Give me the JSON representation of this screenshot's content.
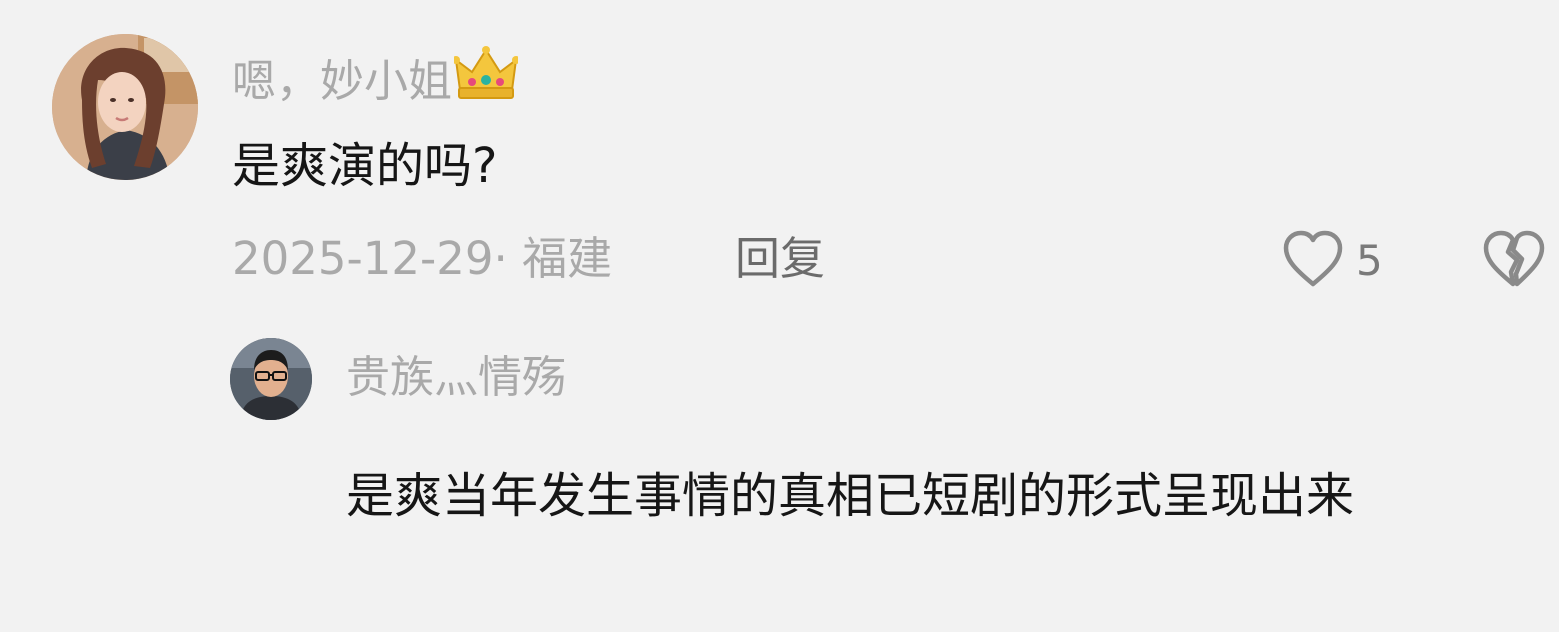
{
  "comment": {
    "username": "嗯，妙小姐",
    "username_emoji": "crown-icon",
    "text": "是爽演的吗?",
    "date_location": "2025-12-29· 福建",
    "reply_label": "回复",
    "like_count": "5",
    "reply": {
      "username": "贵族灬情殇",
      "text": "是爽当年发生事情的真相已短剧的形式呈现出来"
    }
  },
  "colors": {
    "background": "#f2f2f2",
    "username": "#a9a9a9",
    "content": "#161616",
    "meta": "#a9a9a9",
    "reply_button": "#6b6b6b",
    "icon_stroke": "#8a8a8a"
  }
}
